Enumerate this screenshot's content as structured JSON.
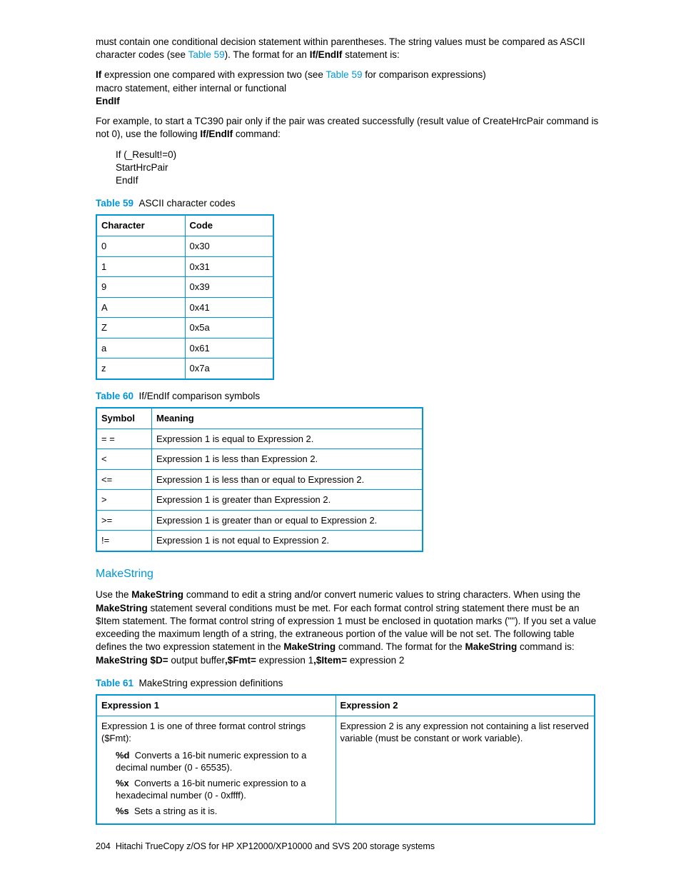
{
  "para1_a": "must contain one conditional decision statement within parentheses. The string values must be compared as ASCII character codes (see ",
  "para1_link": "Table 59",
  "para1_b": "). The format for an ",
  "para1_bold": "If/EndIf",
  "para1_c": " statement is:",
  "line2_bold1": "If",
  "line2_a": " expression one compared with expression two (see ",
  "line2_link": "Table 59",
  "line2_b": " for comparison expressions)",
  "line2_c": "macro statement, either internal or functional",
  "line2_bold2": "EndIf",
  "para3_a": "For example, to start a TC390 pair only if the pair was created successfully (result value of CreateHrcPair command is not 0), use the following ",
  "para3_bold": "If/EndIf",
  "para3_b": " command:",
  "code1": "If (_Result!=0)",
  "code2": "StartHrcPair",
  "code3": "EndIf",
  "t59": {
    "label": "Table 59",
    "caption": "ASCII character codes",
    "h1": "Character",
    "h2": "Code",
    "rows": [
      {
        "c": "0",
        "v": "0x30"
      },
      {
        "c": "1",
        "v": "0x31"
      },
      {
        "c": "9",
        "v": "0x39"
      },
      {
        "c": "A",
        "v": "0x41"
      },
      {
        "c": "Z",
        "v": "0x5a"
      },
      {
        "c": "a",
        "v": "0x61"
      },
      {
        "c": "z",
        "v": "0x7a"
      }
    ]
  },
  "t60": {
    "label": "Table 60",
    "caption": "If/EndIf comparison symbols",
    "h1": "Symbol",
    "h2": "Meaning",
    "rows": [
      {
        "s": "= =",
        "m": "Expression 1 is equal to Expression 2."
      },
      {
        "s": "<",
        "m": "Expression 1 is less than Expression 2."
      },
      {
        "s": "<=",
        "m": "Expression 1 is less than or equal to Expression 2."
      },
      {
        "s": ">",
        "m": "Expression 1 is greater than Expression 2."
      },
      {
        "s": ">=",
        "m": "Expression 1 is greater than or equal to Expression 2."
      },
      {
        "s": "!=",
        "m": "Expression 1 is not equal to Expression 2."
      }
    ]
  },
  "makestring_heading": "MakeString",
  "ms_p_a": "Use the ",
  "ms_p_b1": "MakeString",
  "ms_p_b": " command to edit a string and/or convert numeric values to string characters. When using the ",
  "ms_p_b2": "MakeString",
  "ms_p_c": " statement several conditions must be met. For each format control string statement there must be an $Item statement. The format control string of expression 1 must be enclosed in quotation marks (\"\"). If you set a value exceeding the maximum length of a string, the extraneous portion of the value will be not set. The following table defines the two expression statement in the ",
  "ms_p_b3": "MakeString",
  "ms_p_d": " command. The format for the ",
  "ms_p_b4": "MakeString",
  "ms_p_e": " command is:",
  "ms_fmt_b1": "MakeString $D=",
  "ms_fmt_a": " output buffer",
  "ms_fmt_b2": ",$Fmt=",
  "ms_fmt_b": " expression 1",
  "ms_fmt_b3": ",$Item=",
  "ms_fmt_c": " expression 2",
  "t61": {
    "label": "Table 61",
    "caption": "MakeString expression definitions",
    "h1": "Expression 1",
    "h2": "Expression 2",
    "e1_intro": "Expression 1 is one of three format control strings ($Fmt):",
    "e1_d_b": "%d",
    "e1_d_t": "Converts a 16-bit numeric expression to a decimal number (0 - 65535).",
    "e1_x_b": "%x",
    "e1_x_t": "Converts a 16-bit numeric expression to a hexadecimal number (0 - 0xffff).",
    "e1_s_b": "%s",
    "e1_s_t": "Sets a string as it is.",
    "e2": "Expression 2 is any expression not containing a list reserved variable (must be constant or work variable)."
  },
  "footer_page": "204",
  "footer_text": "Hitachi TrueCopy z/OS for HP XP12000/XP10000 and SVS 200 storage systems"
}
